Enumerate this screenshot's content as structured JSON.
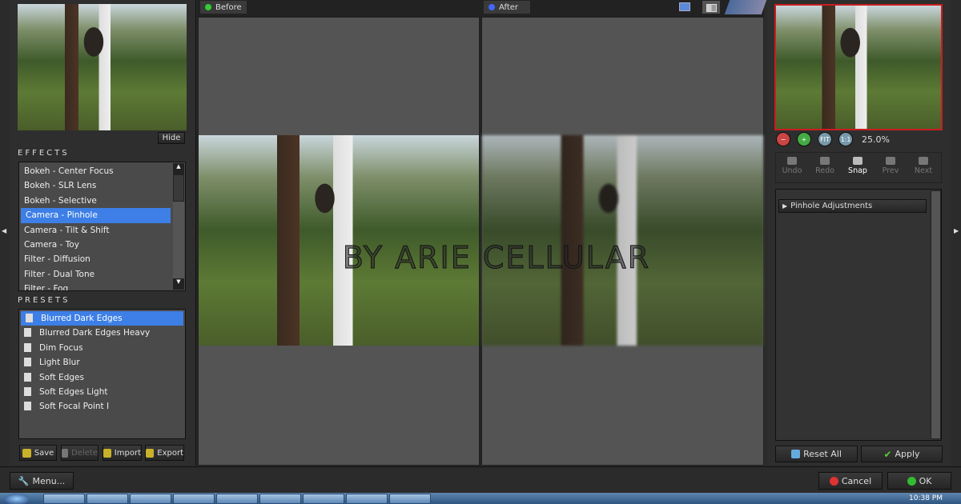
{
  "left": {
    "hide_label": "Hide",
    "effects_header": "EFFECTS",
    "effects": [
      "Bokeh - Center Focus",
      "Bokeh - SLR Lens",
      "Bokeh - Selective",
      "Camera - Pinhole",
      "Camera - Tilt & Shift",
      "Camera - Toy",
      "Filter - Diffusion",
      "Filter - Dual Tone",
      "Filter - Fog"
    ],
    "selected_effect": "Camera - Pinhole",
    "presets_header": "PRESETS",
    "presets": [
      "Blurred Dark Edges",
      "Blurred Dark Edges Heavy",
      "Dim Focus",
      "Light Blur",
      "Soft Edges",
      "Soft Edges Light",
      "Soft Focal Point I"
    ],
    "selected_preset": "Blurred Dark Edges",
    "buttons": {
      "save": "Save",
      "delete": "Delete",
      "import": "Import",
      "export": "Export"
    }
  },
  "view": {
    "before_label": "Before",
    "after_label": "After",
    "watermark": "BY ARIE CELLULAR"
  },
  "right": {
    "zoom_level": "25.0%",
    "zoom_fit": "FIT",
    "zoom_1to1": "1:1",
    "history": {
      "undo": "Undo",
      "redo": "Redo",
      "snap": "Snap",
      "prev": "Prev",
      "next": "Next"
    },
    "section": "Pinhole Adjustments",
    "reset_all": "Reset All",
    "apply": "Apply"
  },
  "footer": {
    "menu": "Menu...",
    "cancel": "Cancel",
    "ok": "OK"
  },
  "taskbar": {
    "clock": "10:38 PM"
  },
  "colors": {
    "accent": "#3d7fe6",
    "preview_border": "#c81e1e"
  }
}
